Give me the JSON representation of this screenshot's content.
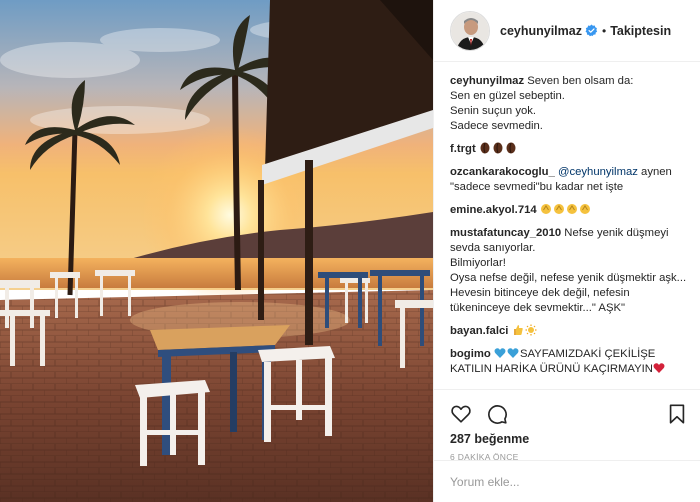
{
  "header": {
    "username": "ceyhunyilmaz",
    "follow_status": "Takiptesin",
    "separator": "•"
  },
  "caption": {
    "username": "ceyhunyilmaz",
    "lines": [
      "Seven ben olsam da:",
      "Sen en güzel sebeptin.",
      "Senin suçun yok.",
      "Sadece sevmedin."
    ]
  },
  "comments": [
    {
      "username": "f.trgt",
      "text": ""
    },
    {
      "username": "ozcankarakocoglu_",
      "mention": "@ceyhunyilmaz",
      "text": " aynen \"sadece sevmedi\"bu kadar net işte"
    },
    {
      "username": "emine.akyol.714",
      "text": ""
    },
    {
      "username": "mustafatuncay_2010",
      "lines": [
        "Nefse yenik düşmeyi sevda sanıyorlar.",
        "Bilmiyorlar!",
        "Oysa nefse değil, nefese yenik düşmektir aşk...",
        "Hevesin bitinceye dek değil, nefesin tükeninceye dek sevmektir...\" AŞK\""
      ]
    },
    {
      "username": "bayan.falci",
      "text": ""
    },
    {
      "username": "bogimo",
      "text": "SAYFAMIZDAKİ ÇEKİLİŞE KATILIN HARİKA ÜRÜNÜ KAÇIRMAYIN"
    }
  ],
  "likes": "287 beğenme",
  "timestamp": "6 DAKİKA ÖNCE",
  "add_comment": {
    "placeholder": "Yorum ekle..."
  },
  "icons": {
    "like": "heart-icon",
    "comment": "comment-icon",
    "save": "bookmark-icon",
    "verified": "verified-badge-icon"
  },
  "colors": {
    "verified_blue": "#3897f0",
    "text": "#262626",
    "muted": "#999999",
    "mention": "#003569"
  }
}
